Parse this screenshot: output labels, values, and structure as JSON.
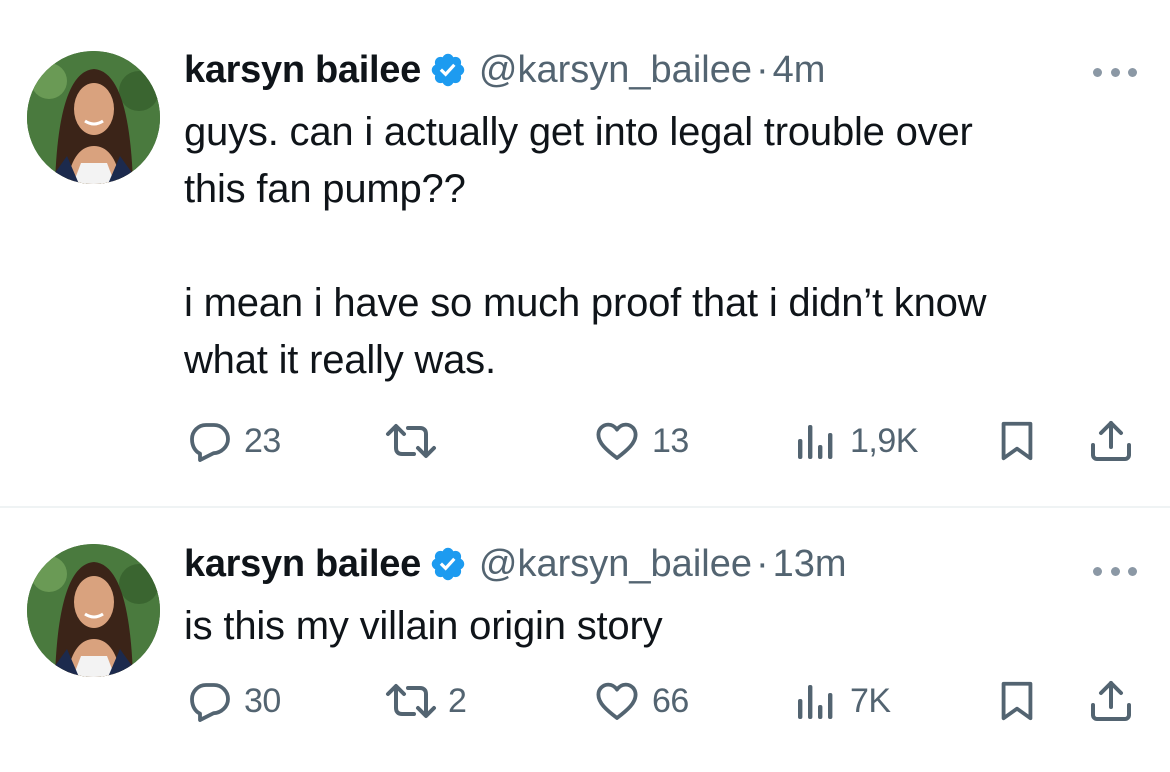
{
  "tweets": [
    {
      "name": "karsyn bailee",
      "handle": "@karsyn_bailee",
      "separator": "·",
      "time": "4m",
      "text_lines": [
        "guys. can i actually get into legal trouble over",
        "this fan pump??",
        "i mean i have so much proof that i didn’t know",
        "what it really was."
      ],
      "replies": "23",
      "retweets": "",
      "likes": "13",
      "views": "1,9K"
    },
    {
      "name": "karsyn bailee",
      "handle": "@karsyn_bailee",
      "separator": "·",
      "time": "13m",
      "text_lines": [
        "is this my villain origin story"
      ],
      "replies": "30",
      "retweets": "2",
      "likes": "66",
      "views": "7K"
    }
  ],
  "icons": {
    "verified": "verified-badge-icon",
    "more": "more-dots-icon",
    "reply": "reply-bubble-icon",
    "retweet": "retweet-icon",
    "like": "heart-icon",
    "views": "views-chart-icon",
    "bookmark": "bookmark-icon",
    "share": "share-icon"
  },
  "colors": {
    "text": "#0f1419",
    "secondary": "#536471",
    "verified": "#1d9bf0",
    "divider": "#eff3f4"
  }
}
